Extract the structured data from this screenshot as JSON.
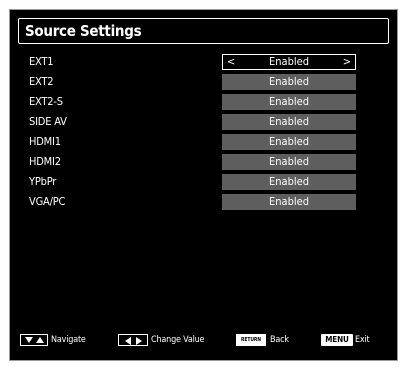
{
  "title": "Source Settings",
  "sources": [
    {
      "name": "EXT1",
      "value": "Enabled",
      "selected": true
    },
    {
      "name": "EXT2",
      "value": "Enabled",
      "selected": false
    },
    {
      "name": "EXT2-S",
      "value": "Enabled",
      "selected": false
    },
    {
      "name": "SIDE AV",
      "value": "Enabled",
      "selected": false
    },
    {
      "name": "HDMI1",
      "value": "Enabled",
      "selected": false
    },
    {
      "name": "HDMI2",
      "value": "Enabled",
      "selected": false
    },
    {
      "name": "YPbPr",
      "value": "Enabled",
      "selected": false
    },
    {
      "name": "VGA/PC",
      "value": "Enabled",
      "selected": false
    }
  ],
  "selector_arrows": {
    "left": "<",
    "right": ">"
  },
  "footer": {
    "navigate": "Navigate",
    "change_value": "Change Value",
    "return_key": "RETURN",
    "back": "Back",
    "menu_key": "MENU",
    "exit": "Exit"
  },
  "icons": {
    "navigate": "up-down-arrows-icon",
    "change_value": "left-right-arrows-icon"
  },
  "colors": {
    "background": "#000000",
    "value_box": "#5e5e5e",
    "text": "#ffffff",
    "outer": "#ffffff"
  }
}
